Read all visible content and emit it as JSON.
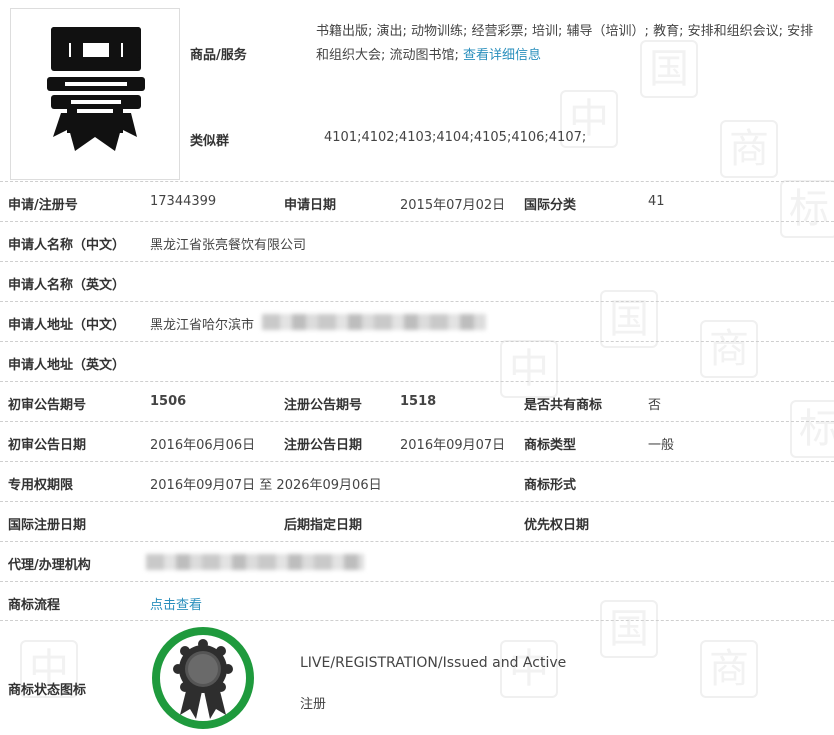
{
  "goods_services": {
    "label": "商品/服务",
    "text": "书籍出版; 演出; 动物训练; 经营彩票; 培训; 辅导（培训）; 教育; 安排和组织会议; 安排和组织大会; 流动图书馆;",
    "detail_link": "查看详细信息"
  },
  "similar_group": {
    "label": "类似群",
    "value": "4101;4102;4103;4104;4105;4106;4107;"
  },
  "rows": {
    "reg_no": {
      "label": "申请/注册号",
      "value": "17344399"
    },
    "apply_date": {
      "label": "申请日期",
      "value": "2015年07月02日"
    },
    "intl_class": {
      "label": "国际分类",
      "value": "41"
    },
    "applicant_cn": {
      "label": "申请人名称（中文）",
      "value": "黑龙江省张亮餐饮有限公司"
    },
    "applicant_en": {
      "label": "申请人名称（英文）",
      "value": ""
    },
    "address_cn": {
      "label": "申请人地址（中文）",
      "value": "黑龙江省哈尔滨市"
    },
    "address_en": {
      "label": "申请人地址（英文）",
      "value": ""
    },
    "prelim_pub_no": {
      "label": "初审公告期号",
      "value": "1506"
    },
    "reg_pub_no": {
      "label": "注册公告期号",
      "value": "1518"
    },
    "shared": {
      "label": "是否共有商标",
      "value": "否"
    },
    "prelim_pub_date": {
      "label": "初审公告日期",
      "value": "2016年06月06日"
    },
    "reg_pub_date": {
      "label": "注册公告日期",
      "value": "2016年09月07日"
    },
    "mark_type": {
      "label": "商标类型",
      "value": "一般"
    },
    "exclusive_period": {
      "label": "专用权期限",
      "value": "2016年09月07日 至 2026年09月06日"
    },
    "mark_form": {
      "label": "商标形式",
      "value": ""
    },
    "intl_reg_date": {
      "label": "国际注册日期",
      "value": ""
    },
    "later_designation": {
      "label": "后期指定日期",
      "value": ""
    },
    "priority_date": {
      "label": "优先权日期",
      "value": ""
    },
    "agent": {
      "label": "代理/办理机构",
      "value": ""
    },
    "process": {
      "label": "商标流程",
      "link": "点击查看"
    }
  },
  "status": {
    "label": "商标状态图标",
    "en": "LIVE/REGISTRATION/Issued and Active",
    "cn": "注册",
    "ring_color": "#1f9a3d"
  },
  "colors": {
    "link": "#2a8fbd",
    "label": "#333333",
    "border": "#cfcfcf"
  },
  "icons": {
    "logo": "zhang-calligraphy-mark-icon",
    "ribbon": "award-ribbon-icon"
  }
}
